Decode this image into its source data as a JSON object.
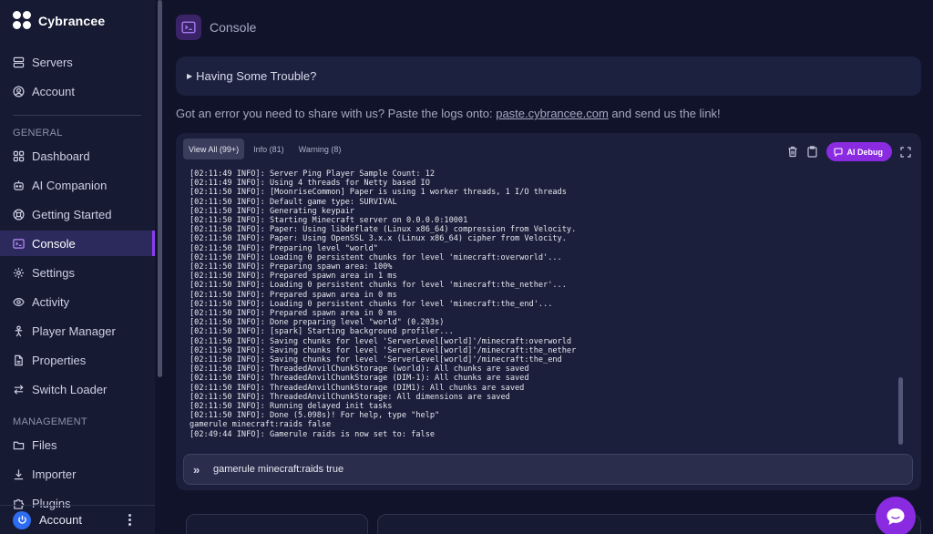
{
  "brand": {
    "name": "Cybrancee"
  },
  "sidebar": {
    "top_items": [
      {
        "label": "Servers",
        "icon": "server-stack-icon"
      },
      {
        "label": "Account",
        "icon": "user-circle-icon"
      }
    ],
    "general_label": "GENERAL",
    "general_items": [
      {
        "label": "Dashboard",
        "icon": "grid-icon"
      },
      {
        "label": "AI Companion",
        "icon": "robot-icon"
      },
      {
        "label": "Getting Started",
        "icon": "lifebuoy-icon"
      },
      {
        "label": "Console",
        "icon": "terminal-icon",
        "active": true
      },
      {
        "label": "Settings",
        "icon": "gear-icon"
      },
      {
        "label": "Activity",
        "icon": "eye-icon"
      },
      {
        "label": "Player Manager",
        "icon": "person-icon"
      },
      {
        "label": "Properties",
        "icon": "document-icon"
      },
      {
        "label": "Switch Loader",
        "icon": "swap-icon"
      }
    ],
    "management_label": "MANAGEMENT",
    "management_items": [
      {
        "label": "Files",
        "icon": "folder-icon"
      },
      {
        "label": "Importer",
        "icon": "download-icon"
      },
      {
        "label": "Plugins",
        "icon": "puzzle-icon"
      }
    ],
    "account_footer": {
      "label": "Account"
    }
  },
  "header": {
    "title": "Console"
  },
  "trouble": {
    "label": "Having Some Trouble?",
    "marker": "▶"
  },
  "paste": {
    "before": "Got an error you need to share with us? Paste the logs onto: ",
    "link": "paste.cybrancee.com",
    "after": " and send us the link!"
  },
  "console": {
    "tabs": [
      {
        "label": "View All (99+)",
        "active": true
      },
      {
        "label": "Info (81)"
      },
      {
        "label": "Warning (8)"
      }
    ],
    "ai_debug_label": "AI Debug",
    "lines": [
      "[02:11:49 INFO]: Server Ping Player Sample Count: 12",
      "[02:11:49 INFO]: Using 4 threads for Netty based IO",
      "[02:11:50 INFO]: [MoonriseCommon] Paper is using 1 worker threads, 1 I/O threads",
      "[02:11:50 INFO]: Default game type: SURVIVAL",
      "[02:11:50 INFO]: Generating keypair",
      "[02:11:50 INFO]: Starting Minecraft server on 0.0.0.0:10001",
      "[02:11:50 INFO]: Paper: Using libdeflate (Linux x86_64) compression from Velocity.",
      "[02:11:50 INFO]: Paper: Using OpenSSL 3.x.x (Linux x86_64) cipher from Velocity.",
      "[02:11:50 INFO]: Preparing level \"world\"",
      "[02:11:50 INFO]: Loading 0 persistent chunks for level 'minecraft:overworld'...",
      "[02:11:50 INFO]: Preparing spawn area: 100%",
      "[02:11:50 INFO]: Prepared spawn area in 1 ms",
      "[02:11:50 INFO]: Loading 0 persistent chunks for level 'minecraft:the_nether'...",
      "[02:11:50 INFO]: Prepared spawn area in 0 ms",
      "[02:11:50 INFO]: Loading 0 persistent chunks for level 'minecraft:the_end'...",
      "[02:11:50 INFO]: Prepared spawn area in 0 ms",
      "[02:11:50 INFO]: Done preparing level \"world\" (0.203s)",
      "[02:11:50 INFO]: [spark] Starting background profiler...",
      "[02:11:50 INFO]: Saving chunks for level 'ServerLevel[world]'/minecraft:overworld",
      "[02:11:50 INFO]: Saving chunks for level 'ServerLevel[world]'/minecraft:the_nether",
      "[02:11:50 INFO]: Saving chunks for level 'ServerLevel[world]'/minecraft:the_end",
      "[02:11:50 INFO]: ThreadedAnvilChunkStorage (world): All chunks are saved",
      "[02:11:50 INFO]: ThreadedAnvilChunkStorage (DIM-1): All chunks are saved",
      "[02:11:50 INFO]: ThreadedAnvilChunkStorage (DIM1): All chunks are saved",
      "[02:11:50 INFO]: ThreadedAnvilChunkStorage: All dimensions are saved",
      "[02:11:50 INFO]: Running delayed init tasks",
      "[02:11:50 INFO]: Done (5.098s)! For help, type \"help\"",
      "gamerule minecraft:raids false",
      "[02:49:44 INFO]: Gamerule raids is now set to: false"
    ],
    "command": {
      "prompt": "»",
      "value": "gamerule minecraft:raids true"
    }
  },
  "colors": {
    "accent": "#8a2be2",
    "background": "#10132a",
    "sidebar": "#161a33",
    "card": "#1b1f3b"
  }
}
